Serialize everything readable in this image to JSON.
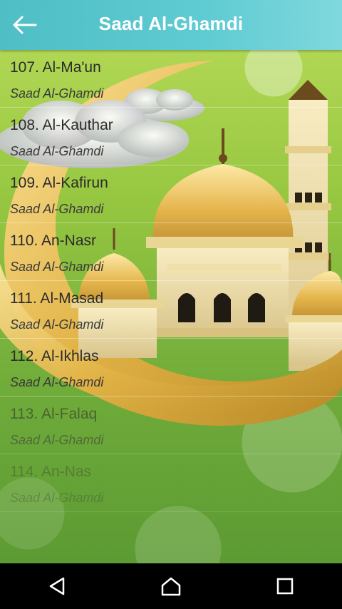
{
  "appbar": {
    "title": "Saad Al-Ghamdi",
    "back_icon": "arrow-left-icon"
  },
  "list": {
    "items": [
      {
        "title": "107. Al-Ma'un",
        "subtitle": "Saad Al-Ghamdi"
      },
      {
        "title": "108. Al-Kauthar",
        "subtitle": "Saad Al-Ghamdi"
      },
      {
        "title": "109. Al-Kafirun",
        "subtitle": "Saad Al-Ghamdi"
      },
      {
        "title": "110. An-Nasr",
        "subtitle": "Saad Al-Ghamdi"
      },
      {
        "title": "111. Al-Masad",
        "subtitle": "Saad Al-Ghamdi"
      },
      {
        "title": "112. Al-Ikhlas",
        "subtitle": "Saad Al-Ghamdi"
      },
      {
        "title": "113. Al-Falaq",
        "subtitle": "Saad Al-Ghamdi"
      },
      {
        "title": "114. An-Nas",
        "subtitle": "Saad Al-Ghamdi"
      }
    ]
  },
  "navbar": {
    "back_icon": "nav-back-icon",
    "home_icon": "nav-home-icon",
    "recents_icon": "nav-recents-icon"
  },
  "colors": {
    "appbar": "#5fcbd2",
    "background_green": "#97c741",
    "gold": "#e3b54a"
  }
}
